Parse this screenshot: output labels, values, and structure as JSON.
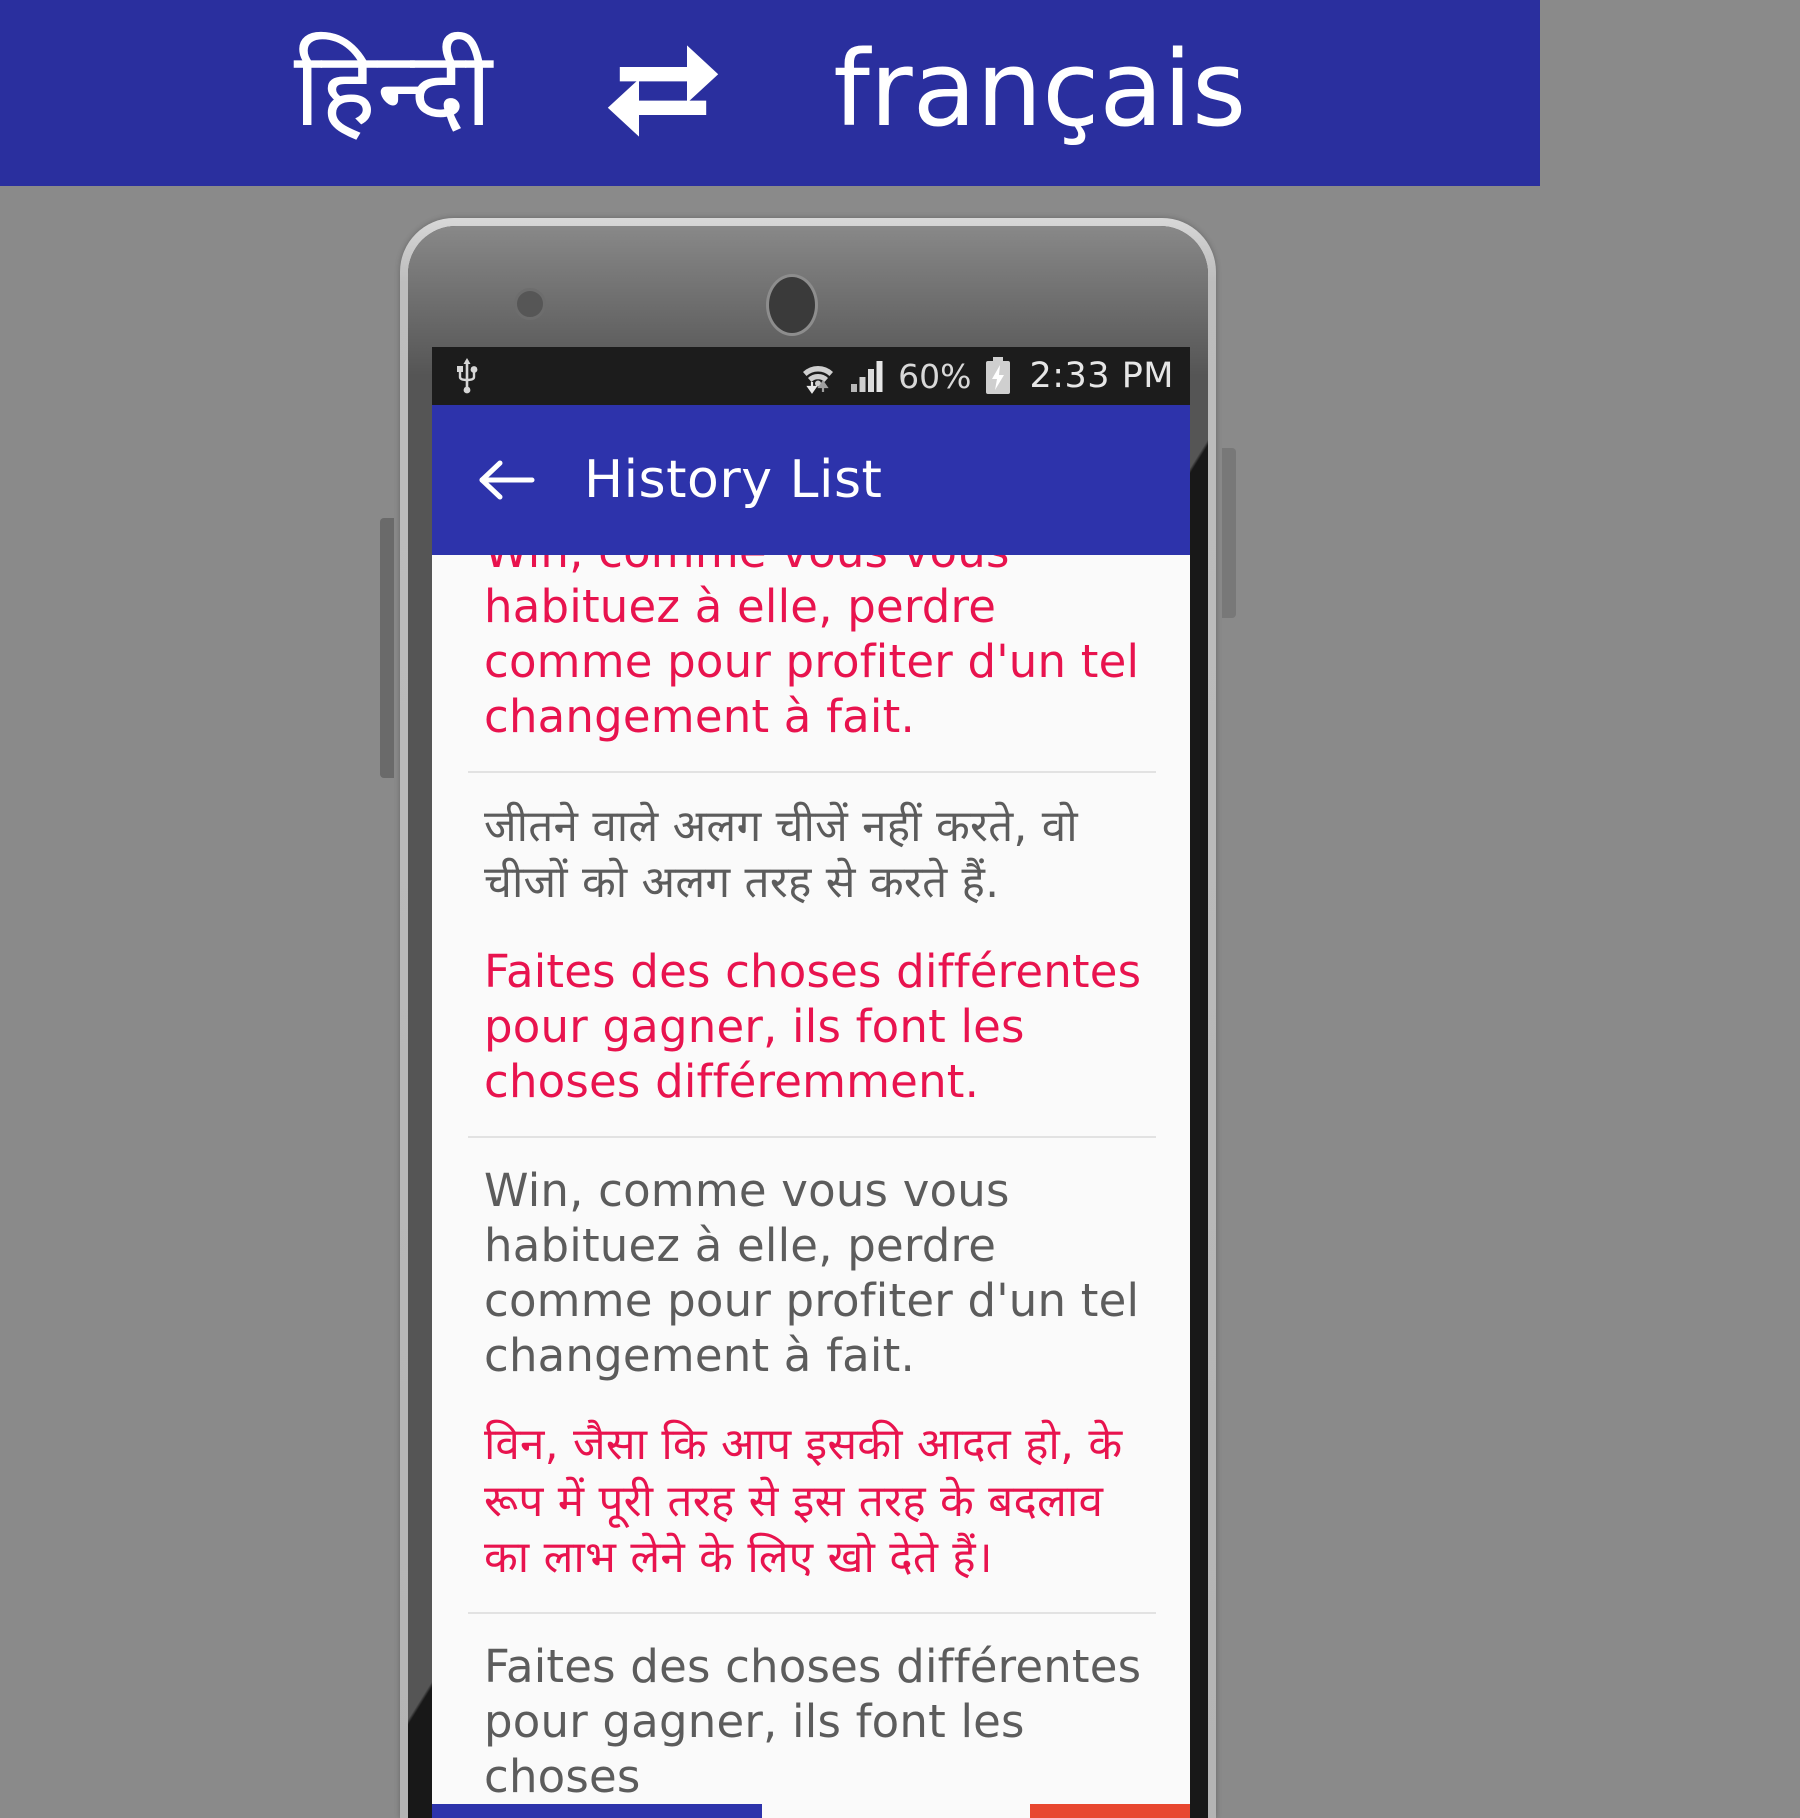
{
  "promo": {
    "source_language": "हिन्दी",
    "swap_icon": "swap-repeat-icon",
    "target_language": "français",
    "banner_color": "#2a2f9e"
  },
  "phone": {
    "status_bar": {
      "usb_icon": "usb-icon",
      "wifi_icon": "wifi-transfer-icon",
      "signal_icon": "cellular-signal-icon",
      "battery_percent": "60%",
      "battery_icon": "battery-charging-icon",
      "time": "2:33 PM",
      "background_color": "#1c1c1c"
    },
    "app_bar": {
      "back_icon": "back-arrow-icon",
      "title": "History List",
      "background_color": "#2d33ab"
    }
  },
  "history": {
    "colors": {
      "source_text": "#5c5c5c",
      "translated_text": "#e8134e"
    },
    "items": [
      {
        "clipped": true,
        "source_text": "Win, comme vous vous habituez à elle, perdre comme pour profiter d'un tel changement à fait.",
        "source_lang": "fr",
        "source_color": "pink",
        "visible_fragment": "fait."
      },
      {
        "source_text": "जीतने वाले अलग चीजें नहीं करते, वो चीजों को  अलग तरह से करते हैं.",
        "source_lang": "hi",
        "source_color": "grey",
        "translated_text": "Faites des choses différentes pour gagner, ils font les choses différemment.",
        "translated_lang": "fr",
        "translated_color": "pink"
      },
      {
        "source_text": "Win, comme vous vous habituez à elle, perdre comme pour profiter d'un tel changement à fait.",
        "source_lang": "fr",
        "source_color": "grey",
        "translated_text": "विन, जैसा कि आप इसकी आदत हो, के रूप में पूरी तरह से इस तरह के बदलाव का लाभ लेने के लिए खो देते हैं।",
        "translated_lang": "hi",
        "translated_color": "pink"
      },
      {
        "source_text": "Faites des choses différentes pour gagner, ils font les choses",
        "source_lang": "fr",
        "source_color": "grey",
        "clipped_bottom": true
      }
    ]
  }
}
